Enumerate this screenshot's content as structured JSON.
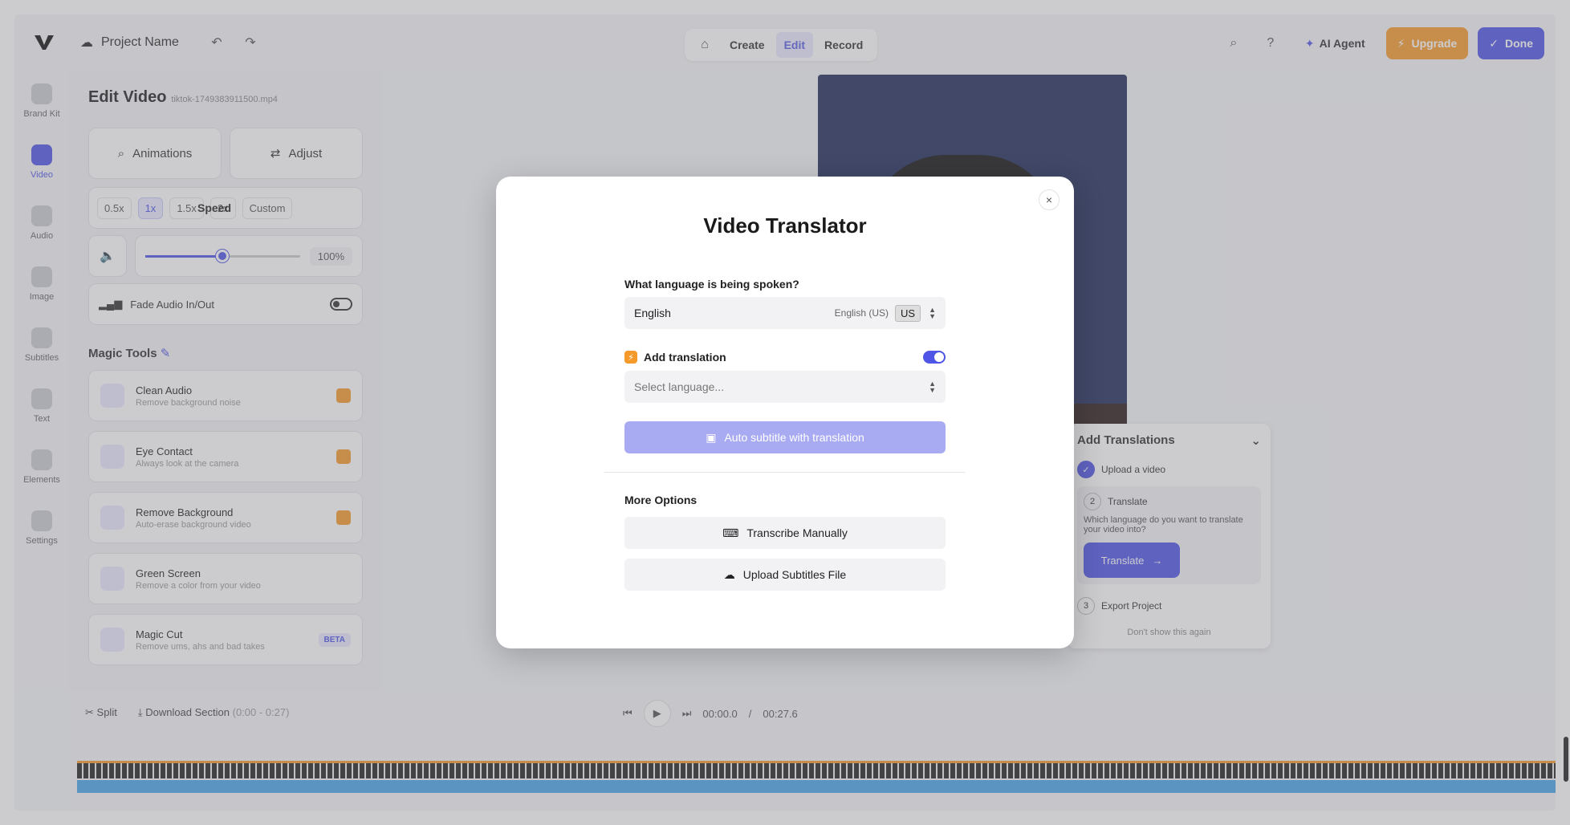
{
  "topbar": {
    "project_name": "Project Name",
    "modes": [
      "Create",
      "Edit",
      "Record"
    ],
    "active_mode": "Edit",
    "ai_agent_label": "AI Agent",
    "upgrade_label": "Upgrade",
    "done_label": "Done"
  },
  "rail": {
    "items": [
      {
        "label": "Brand Kit",
        "icon": "brand-kit-icon"
      },
      {
        "label": "Video",
        "icon": "video-icon"
      },
      {
        "label": "Audio",
        "icon": "audio-icon"
      },
      {
        "label": "Image",
        "icon": "image-icon"
      },
      {
        "label": "Subtitles",
        "icon": "subtitles-icon"
      },
      {
        "label": "Text",
        "icon": "text-icon"
      },
      {
        "label": "Elements",
        "icon": "elements-icon"
      },
      {
        "label": "Settings",
        "icon": "settings-icon"
      }
    ],
    "active": "Video"
  },
  "panel": {
    "title": "Edit Video",
    "filename": "tiktok-1749383911500.mp4",
    "animations_label": "Animations",
    "adjust_label": "Adjust",
    "speed_label": "Speed",
    "speed_options": [
      "0.5x",
      "1x",
      "1.5x",
      "2x",
      "Custom"
    ],
    "speed_active": "1x",
    "volume_value": "100%",
    "volume_level": 0.5,
    "fade_label": "Fade Audio In/Out",
    "magic_tools_title": "Magic Tools",
    "tools": [
      {
        "name": "Clean Audio",
        "desc": "Remove background noise",
        "badge": "upgrade"
      },
      {
        "name": "Eye Contact",
        "desc": "Always look at the camera",
        "badge": "upgrade"
      },
      {
        "name": "Remove Background",
        "desc": "Auto-erase background video",
        "badge": "upgrade"
      },
      {
        "name": "Green Screen",
        "desc": "Remove a color from your video",
        "badge": ""
      },
      {
        "name": "Magic Cut",
        "desc": "Remove ums, ahs and bad takes",
        "badge": "BETA"
      }
    ]
  },
  "timeline": {
    "split_label": "Split",
    "download_label": "Download Section",
    "range": "(0:00 - 0:27)",
    "current_time": "00:00.0",
    "separator": "/",
    "total_time": "00:27.6"
  },
  "add_translations": {
    "title": "Add Translations",
    "step1": "Upload a video",
    "step2": "Translate",
    "step2_question": "Which language do you want to translate your video into?",
    "translate_btn": "Translate",
    "step3": "Export Project",
    "dont_show": "Don't show this again"
  },
  "modal": {
    "title": "Video Translator",
    "close_symbol": "×",
    "spoken_label": "What language is being spoken?",
    "spoken_value": "English",
    "spoken_sub": "English (US)",
    "spoken_flag": "US",
    "add_translation_label": "Add translation",
    "add_translation_on": true,
    "select_placeholder": "Select language...",
    "auto_subtitle_label": "Auto subtitle with translation",
    "more_options_label": "More Options",
    "transcribe_label": "Transcribe Manually",
    "upload_label": "Upload Subtitles File"
  },
  "colors": {
    "accent": "#4f55e6",
    "upgrade": "#f59a2a",
    "accent_disabled": "#a9abf2"
  }
}
